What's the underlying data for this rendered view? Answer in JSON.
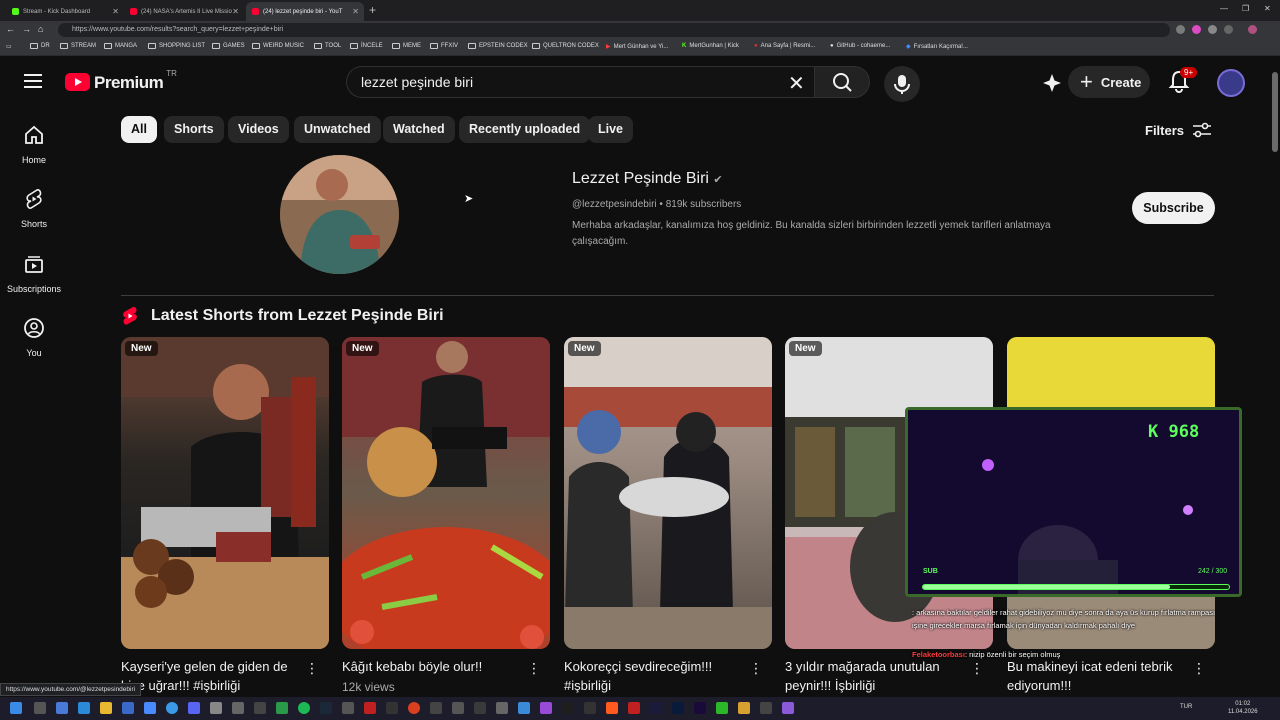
{
  "browser": {
    "tabs": [
      {
        "title": "Stream - Kick Dashboard",
        "color": "#53fc18"
      },
      {
        "title": "(24) NASA's Artemis II Live Missio",
        "color": "#ff0033"
      },
      {
        "title": "(24) lezzet peşinde biri - YouT",
        "color": "#ff0033"
      }
    ],
    "url": "https://www.youtube.com/results?search_query=lezzet+peşinde+biri",
    "bookmarks": [
      "DR",
      "STREAM",
      "MANGA",
      "SHOPPING LIST",
      "GAMES",
      "WEIRD MUSIC",
      "TOOL",
      "İNCELE",
      "MEME",
      "FFXIV",
      "EPSTEIN CODEX",
      "QUELTRON CODEX",
      "Mert Günhan ve Yi...",
      "MertGunhan | Kick",
      "Ana Sayfa | Resmi...",
      "GitHub - cohaeme...",
      "Fırsatları Kaçırma!..."
    ]
  },
  "header": {
    "logo_text": "Premium",
    "region": "TR",
    "search_value": "lezzet peşinde biri",
    "create_label": "Create",
    "notification_count": "9+"
  },
  "sidebar": {
    "items": [
      {
        "label": "Home",
        "icon": "home-icon"
      },
      {
        "label": "Shorts",
        "icon": "shorts-icon"
      },
      {
        "label": "Subscriptions",
        "icon": "subscriptions-icon"
      },
      {
        "label": "You",
        "icon": "you-icon"
      }
    ]
  },
  "chips": [
    "All",
    "Shorts",
    "Videos",
    "Unwatched",
    "Watched",
    "Recently uploaded",
    "Live"
  ],
  "filters_label": "Filters",
  "channel": {
    "name": "Lezzet Peşinde Biri",
    "handle": "@lezzetpesindebiri",
    "subscribers": "819k subscribers",
    "description": "Merhaba arkadaşlar, kanalımıza hoş geldiniz. Bu kanalda sizleri birbirinden lezzetli yemek tarifleri anlatmaya çalışacağım.",
    "subscribe_label": "Subscribe"
  },
  "shorts_section": {
    "title": "Latest Shorts from Lezzet Peşinde Biri",
    "items": [
      {
        "badge": "New",
        "title": "Kayseri'ye gelen de giden de bize uğrar!!! #işbirliği",
        "views": ""
      },
      {
        "badge": "New",
        "title": "Kâğıt kebabı böyle olur!!",
        "views": "12k views"
      },
      {
        "badge": "New",
        "title": "Kokoreççi sevdireceğim!!! #işbirliği",
        "views": ""
      },
      {
        "badge": "New",
        "title": "3 yıldır mağarada unutulan peynir!!! İşbirliği",
        "views": ""
      },
      {
        "badge": "",
        "title": "Bu makineyi icat edeni tebrik ediyorum!!!",
        "views": ""
      }
    ]
  },
  "overlay": {
    "count": "K 968",
    "sub_label": "SUB",
    "progress_text": "242 / 300",
    "progress_fraction": 0.807,
    "chat": [
      {
        "user": "",
        "text": ": arkasına baktılar geldiler rahat gidebiliyoz mu diye sonra da aya üs kurup fırlatma rampası işine girecekler marsa fırlamak için dünyadan kaldırmak pahalı diye"
      },
      {
        "user": "Felaketoorbası",
        "text": ": nizip özenli bir seçim olmuş"
      }
    ]
  },
  "status_url": "https://www.youtube.com/@lezzetpesindebiri",
  "taskbar": {
    "lang": "TUR",
    "time": "01:02",
    "date": "11.04.2026"
  }
}
